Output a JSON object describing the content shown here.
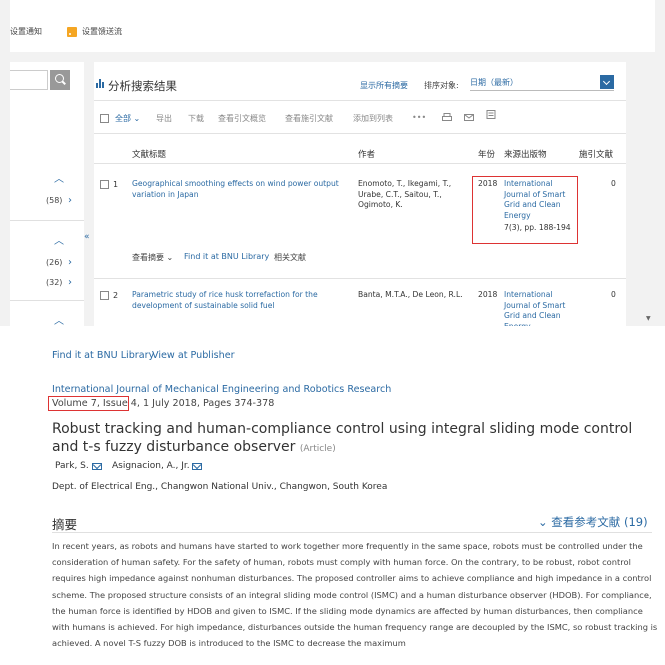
{
  "top": {
    "topbar": {
      "email_alert": "设置通知",
      "rss_alert": "设置馈送流"
    },
    "facets": {
      "counts": [
        "(58)",
        "(26)",
        "(32)"
      ]
    },
    "results": {
      "title": "分析搜索结果",
      "show_abstracts": "显示所有摘要",
      "sort_label": "排序对象:",
      "sort_value": "日期（最新）",
      "toolbar": {
        "select_all": "全部",
        "export": "导出",
        "download": "下载",
        "view_citations": "查看引文概览",
        "view_cited_by": "查看施引文献",
        "add_to_list": "添加到列表",
        "more": "•••"
      },
      "columns": {
        "title": "文献标题",
        "authors": "作者",
        "year": "年份",
        "source": "来源出版物",
        "cited": "施引文献"
      },
      "rows": [
        {
          "num": "1",
          "title": "Geographical smoothing effects on wind power output variation in Japan",
          "authors": "Enomoto, T., Ikegami, T., Urabe, C.T., Saitou, T., Ogimoto, K.",
          "year": "2018",
          "source": "International Journal of Smart Grid and Clean Energy",
          "source_detail": "7(3), pp. 188-194",
          "cited": "0",
          "actions": {
            "view_abstract": "查看摘要",
            "find_at": "Find it at BNU Library",
            "related": "相关文献"
          }
        },
        {
          "num": "2",
          "title": "Parametric study of rice husk torrefaction for the development of sustainable solid fuel",
          "authors": "Banta, M.T.A., De Leon, R.L.",
          "year": "2018",
          "source": "International Journal of Smart Grid and Clean Energy",
          "cited": "0"
        }
      ]
    }
  },
  "bottom": {
    "find_links": {
      "bnu": "Find it at BNU Library",
      "publisher": "View at Publisher"
    },
    "journal": "International Journal of Mechanical Engineering and Robotics Research",
    "volume": "Volume 7, Issue 4",
    "date_pages": ", 1 July 2018, Pages 374-378",
    "title": "Robust tracking and human-compliance control using integral sliding mode control and t-s fuzzy disturbance observer",
    "type": "(Article)",
    "authors": [
      "Park, S.",
      "Asignacion, A., Jr."
    ],
    "affiliation": "Dept. of Electrical Eng., Changwon National Univ., Changwon, South Korea",
    "abstract_heading": "摘要",
    "refs_link": "查看参考文献 (19)",
    "abstract": "In recent years, as robots and humans have started to work together more frequently in the same space, robots must be controlled under the consideration of human safety. For the safety of human, robots must comply with human force. On the contrary, to be robust, robot control requires high impedance against nonhuman disturbances. The proposed controller aims to achieve compliance and high impedance in a control scheme. The proposed structure consists of an integral sliding mode control (ISMC) and a human disturbance observer (HDOB). For compliance, the human force is identified by HDOB and given to ISMC. If the sliding mode dynamics are affected by human disturbances, then compliance with humans is achieved. For high impedance, disturbances outside the human frequency range are decoupled by the ISMC, so robust tracking is achieved. A novel T-S fuzzy DOB is introduced to the ISMC to decrease the maximum"
  },
  "colors": {
    "link": "#2b6aa3",
    "highlight": "#dd3333",
    "rss": "#f5a623"
  }
}
